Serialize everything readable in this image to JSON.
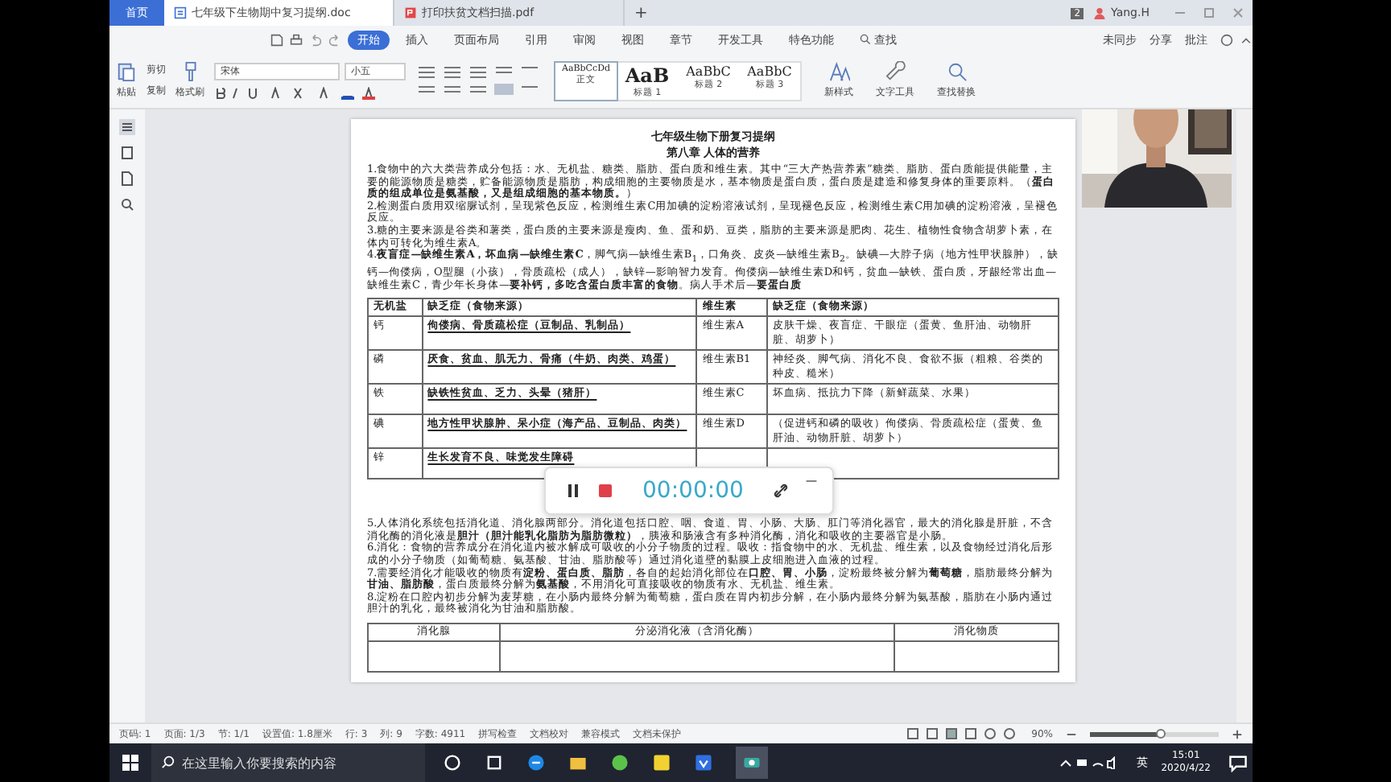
{
  "tabs": [
    {
      "label": "首页",
      "kind": "home",
      "selected": false
    },
    {
      "label": "七年级下生物期中复习提纲.doc",
      "kind": "doc",
      "selected": true
    },
    {
      "label": "打印扶贫文档扫描.pdf",
      "kind": "pdf",
      "selected": false
    },
    {
      "label": "+",
      "kind": "new",
      "selected": false
    }
  ],
  "titlebar": {
    "badge": "2",
    "user": "Yang.H"
  },
  "menu": [
    {
      "label": "开始",
      "selected": true
    },
    {
      "label": "插入",
      "selected": false
    },
    {
      "label": "页面布局",
      "selected": false
    },
    {
      "label": "引用",
      "selected": false
    },
    {
      "label": "审阅",
      "selected": false
    },
    {
      "label": "视图",
      "selected": false
    },
    {
      "label": "章节",
      "selected": false
    },
    {
      "label": "开发工具",
      "selected": false
    },
    {
      "label": "特色功能",
      "selected": false
    }
  ],
  "menu_search": "查找",
  "menu_right": [
    "未同步",
    "分享",
    "批注"
  ],
  "ribbon": {
    "paste": "粘贴",
    "cut": "剪切",
    "copy": "复制",
    "format_painter": "格式刷",
    "font": "宋体",
    "size": "小五",
    "styles": [
      {
        "preview": "AaBbCcDd",
        "label": "正文",
        "selected": true
      },
      {
        "preview": "AaB",
        "label": "标题 1",
        "selected": false
      },
      {
        "preview": "AaBbC",
        "label": "标题 2",
        "selected": false
      },
      {
        "preview": "AaBbC",
        "label": "标题 3",
        "selected": false
      }
    ],
    "tools": [
      {
        "label": "新样式",
        "kind": "style"
      },
      {
        "label": "文字工具",
        "kind": "wrench"
      },
      {
        "label": "查找替换",
        "kind": "find"
      }
    ]
  },
  "document": {
    "title": "七年级生物下册复习提纲",
    "subtitle": "第八章 人体的营养",
    "paragraphs_top": [
      "1.食物中的六大类营养成分包括：水、无机盐、糖类、脂肪、蛋白质和维生素。其中“三大产热营养素”糖类、脂肪、蛋白质能提供能量，主要的能源物质是糖类，贮备能源物质是脂肪，构成细胞的主要物质是水，基本物质是蛋白质，蛋白质是建造和修复身体的重要原料。（**蛋白质的组成单位是氨基酸，又是组成细胞的基本物质。**）",
      "2.检测蛋白质用双缩脲试剂，呈现紫色反应，检测维生素C用加碘的淀粉溶液试剂，呈现褪色反应，检测维生素C用加碘的淀粉溶液，呈褪色反应。",
      "3.糖的主要来源是谷类和薯类，蛋白质的主要来源是瘦肉、鱼、蛋和奶、豆类，脂肪的主要来源是肥肉、花生、植物性食物含胡萝卜素，在体内可转化为维生素A。",
      "4.**夜盲症—缺维生素A，坏血病—缺维生素C**，脚气病—缺维生素B$_{1}$，口角炎、皮炎—缺维生素B$_{2}$。缺碘—大脖子病（地方性甲状腺肿），缺钙—佝偻病，O型腿（小孩），骨质疏松（成人），缺锌—影响智力发育。佝偻病—缺维生素D和钙，贫血—缺铁、蛋白质，牙龈经常出血—缺维生素C，青少年长身体—**要补钙，多吃含蛋白质丰富的食物**。病人手术后—**要蛋白质**"
    ],
    "table": {
      "columns": [
        "无机盐",
        "缺乏症（食物来源）",
        "维生素",
        "缺乏症（食物来源）"
      ],
      "rows": [
        [
          "钙",
          "佝偻病、骨质疏松症（豆制品、乳制品）",
          "维生素A",
          "皮肤干燥、夜盲症、干眼症（蛋黄、鱼肝油、动物肝脏、胡萝卜）"
        ],
        [
          "磷",
          "厌食、贫血、肌无力、骨痛（牛奶、肉类、鸡蛋）",
          "维生素B1",
          "神经炎、脚气病、消化不良、食欲不振（粗粮、谷类的种皮、糙米）"
        ],
        [
          "铁",
          "缺铁性贫血、乏力、头晕（猪肝）",
          "维生素C",
          "坏血病、抵抗力下降（新鲜蔬菜、水果）"
        ],
        [
          "碘",
          "地方性甲状腺肿、呆小症（海产品、豆制品、肉类）",
          "维生素D",
          "（促进钙和磷的吸收）佝偻病、骨质疏松症（蛋黄、鱼肝油、动物肝脏、胡萝卜）"
        ],
        [
          "锌",
          "生长发育不良、味觉发生障碍",
          "",
          ""
        ]
      ]
    },
    "paragraphs_bottom": [
      "5.人体消化系统包括消化道、消化腺两部分。消化道包括口腔、咽、食道、胃、小肠、大肠、肛门等消化器官，最大的消化腺是肝脏，不含消化酶的消化液是**胆汁（胆汁能乳化脂肪为脂肪微粒）**，胰液和肠液含有多种消化酶，消化和吸收的主要器官是小肠。",
      "6.消化：食物的营养成分在消化道内被水解成可吸收的小分子物质的过程。吸收：指食物中的水、无机盐、维生素，以及食物经过消化后形成的小分子物质（如葡萄糖、氨基酸、甘油、脂肪酸等）通过消化道壁的黏膜上皮细胞进入血液的过程。",
      "7.需要经消化才能吸收的物质有**淀粉、蛋白质、脂肪**，各自的起始消化部位在**口腔、胃、小肠**，淀粉最终被分解为**葡萄糖**，脂肪最终分解为**甘油、脂肪酸**，蛋白质最终分解为**氨基酸**，不用消化可直接吸收的物质有水、无机盐、维生素。",
      "8.淀粉在口腔内初步分解为麦芽糖，在小肠内最终分解为葡萄糖，蛋白质在胃内初步分解，在小肠内最终分解为氨基酸，脂肪在小肠内通过胆汁的乳化，最终被消化为甘油和脂肪酸。"
    ],
    "table2": {
      "columns": [
        "消化腺",
        "分泌消化液（含消化酶）",
        "消化物质"
      ]
    }
  },
  "recorder": {
    "time": "00:00:00"
  },
  "status_bar": [
    "页码: 1",
    "页面: 1/3",
    "节: 1/1",
    "设置值: 1.8厘米",
    "行: 3",
    "列: 9",
    "字数: 4911",
    "拼写检查",
    "文档校对",
    "兼容模式",
    "文档未保护"
  ],
  "zoom": {
    "label": "90%",
    "level": 0.55
  },
  "taskbar": {
    "search_placeholder": "在这里输入你要搜索的内容",
    "language": "英",
    "time": "15:01",
    "date": "2020/4/22"
  }
}
